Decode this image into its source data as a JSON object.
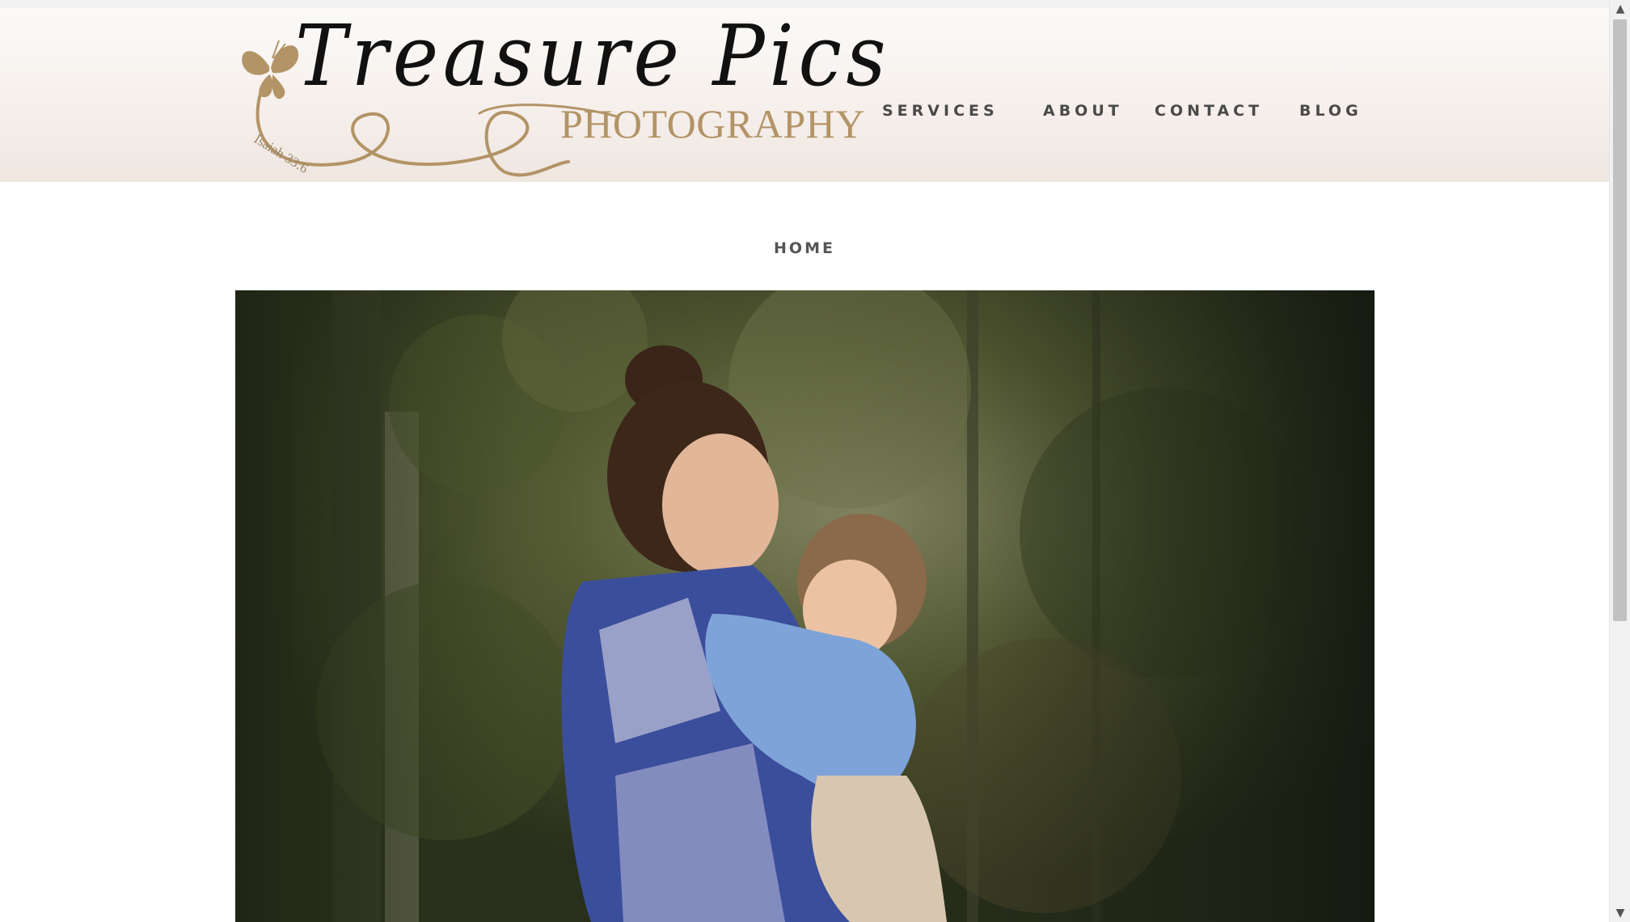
{
  "site": {
    "logo": {
      "title": "Treasure Pics",
      "subtitle": "PHOTOGRAPHY",
      "verse": "Isaiah 33:6",
      "icon": "butterfly-icon"
    }
  },
  "nav": {
    "items": [
      {
        "label": "SERVICES"
      },
      {
        "label": "ABOUT"
      },
      {
        "label": "CONTACT"
      },
      {
        "label": "BLOG"
      }
    ]
  },
  "page": {
    "title": "HOME"
  },
  "hero": {
    "icon": "hero-photo"
  },
  "scrollbar": {
    "up_icon": "▲",
    "down_icon": "▼"
  },
  "colors": {
    "brand_gold": "#b39467",
    "nav_text": "#4a4a4a",
    "header_bg": "#f6f0ec"
  }
}
